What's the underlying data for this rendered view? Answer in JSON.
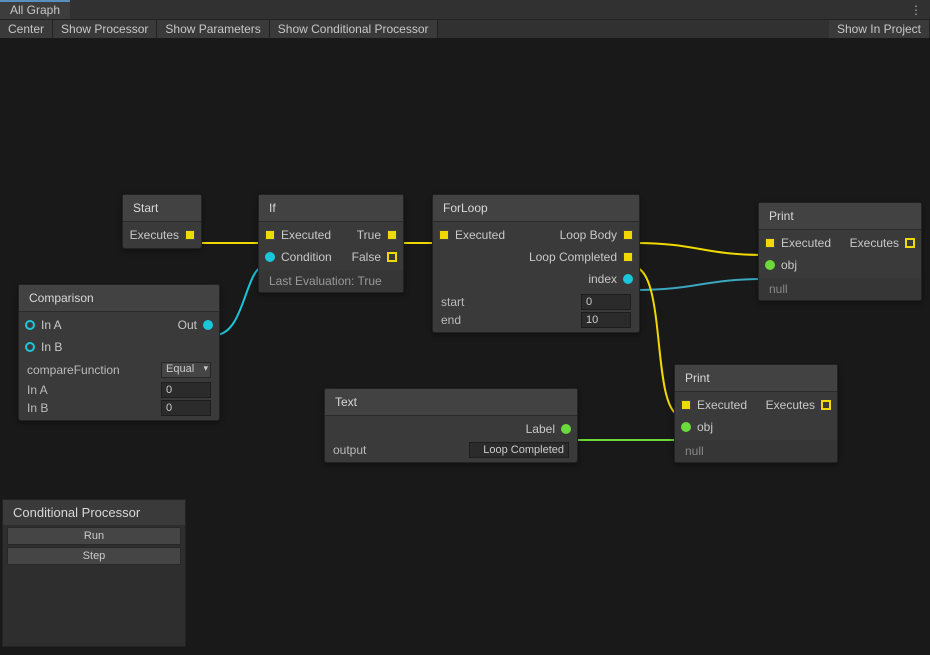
{
  "tabs": {
    "allGraph": "All Graph"
  },
  "toolbar": {
    "center": "Center",
    "showProcessor": "Show Processor",
    "showParameters": "Show Parameters",
    "showConditional": "Show Conditional Processor",
    "showInProject": "Show In Project"
  },
  "nodes": {
    "start": {
      "title": "Start",
      "executes": "Executes"
    },
    "if": {
      "title": "If",
      "executed": "Executed",
      "condition": "Condition",
      "true": "True",
      "false": "False",
      "lastEval": "Last Evaluation: True"
    },
    "comparison": {
      "title": "Comparison",
      "inA": "In A",
      "inB": "In B",
      "out": "Out",
      "compareFn": "compareFunction",
      "compareVal": "Equal",
      "inALabel": "In A",
      "inAVal": "0",
      "inBLabel": "In B",
      "inBVal": "0"
    },
    "forloop": {
      "title": "ForLoop",
      "executed": "Executed",
      "loopBody": "Loop Body",
      "loopCompleted": "Loop Completed",
      "index": "index",
      "startLabel": "start",
      "startVal": "0",
      "endLabel": "end",
      "endVal": "10"
    },
    "text": {
      "title": "Text",
      "label": "Label",
      "outputLabel": "output",
      "outputVal": "Loop Completed"
    },
    "print1": {
      "title": "Print",
      "executed": "Executed",
      "executes": "Executes",
      "obj": "obj",
      "null": "null"
    },
    "print2": {
      "title": "Print",
      "executed": "Executed",
      "executes": "Executes",
      "obj": "obj",
      "null": "null"
    }
  },
  "panel": {
    "title": "Conditional Processor",
    "run": "Run",
    "step": "Step"
  },
  "colors": {
    "exec": "#efd900",
    "cyan": "#1ac6d9",
    "green": "#6cd93a"
  }
}
